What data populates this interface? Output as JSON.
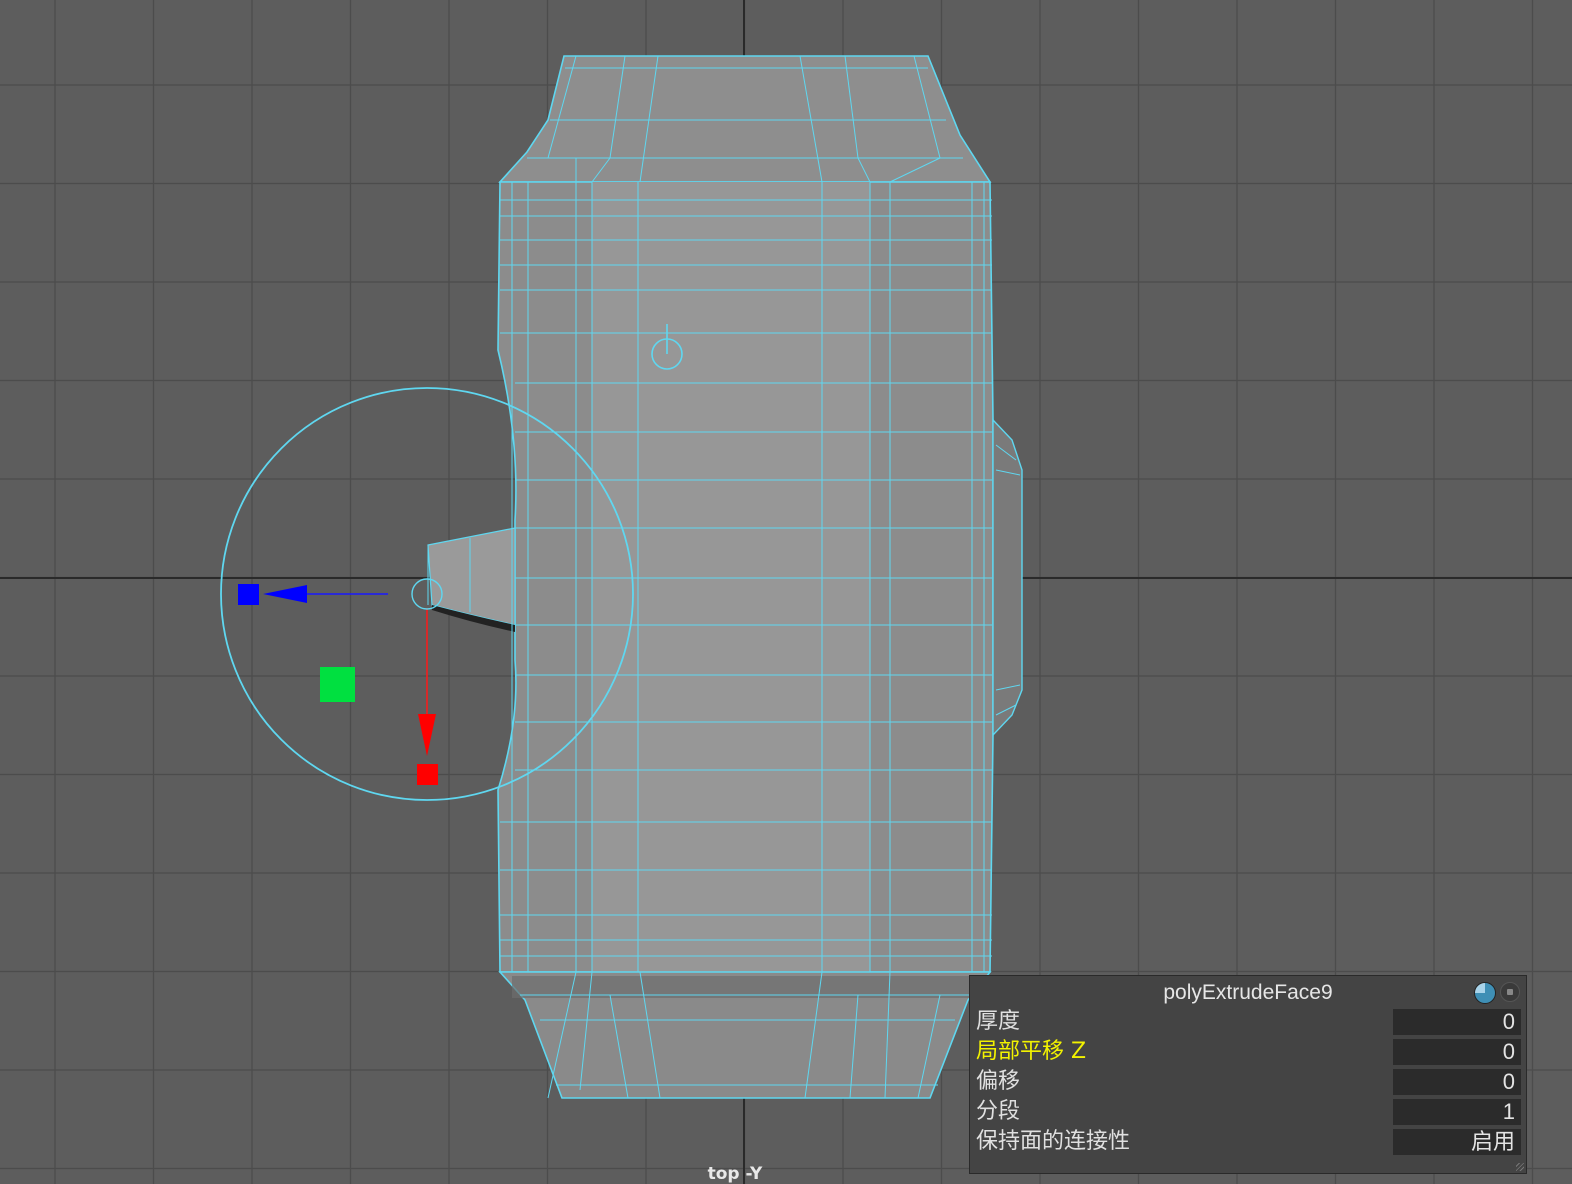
{
  "viewport": {
    "camera_label": "top -Y"
  },
  "channel_box": {
    "title": "polyExtrudeFace9",
    "rows": [
      {
        "label": "厚度",
        "value": "0",
        "highlighted": false
      },
      {
        "label": "局部平移 Z",
        "value": "0",
        "highlighted": true
      },
      {
        "label": "偏移",
        "value": "0",
        "highlighted": false
      },
      {
        "label": "分段",
        "value": "1",
        "highlighted": false
      },
      {
        "label": "保持面的连接性",
        "value": "启用",
        "highlighted": false
      }
    ],
    "icons": [
      "node-state-icon",
      "close-icon"
    ]
  },
  "colors": {
    "background": "#5d5d5d",
    "grid": "#4a4a4a",
    "wireframe": "#5fd7f0",
    "mesh_fill": "#8b8b8b",
    "manipulator_x": "#ff0000",
    "manipulator_y": "#00ff00",
    "manipulator_z": "#0000ff",
    "highlight_text": "#f2f200"
  }
}
